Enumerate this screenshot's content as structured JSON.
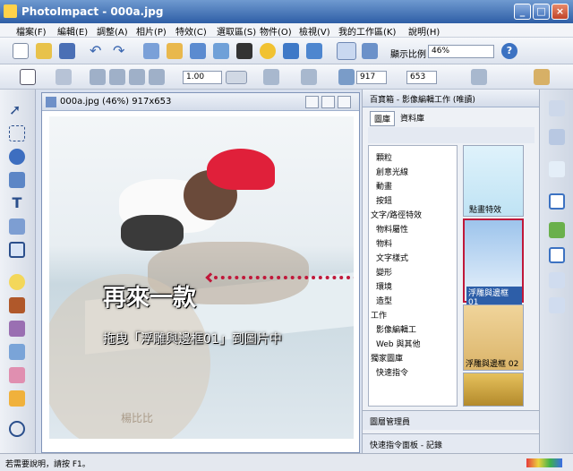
{
  "window": {
    "title": "PhotoImpact - 000a.jpg"
  },
  "menu": [
    "檔案(F)",
    "編輯(E)",
    "調整(A)",
    "相片(P)",
    "特效(C)",
    "選取區(S)",
    "物件(O)",
    "檢視(V)",
    "我的工作區(K)",
    "說明(H)"
  ],
  "toolbar": {
    "zoom_label": "顯示比例",
    "zoom_value": "46%"
  },
  "toolbar2": {
    "rotate_value": "1.00",
    "width_value": "917",
    "height_value": "653"
  },
  "document": {
    "title": "000a.jpg (46%) 917x653"
  },
  "canvas": {
    "heading": "再來一款",
    "instruction": "拖曳「浮雕與邊框01」到圖片中",
    "watermark": "楊比比"
  },
  "panel": {
    "title": "百寶箱 - 影像編輯工作 (唯讀)",
    "tabs": [
      "圖庫",
      "資料庫"
    ],
    "tree": [
      "顆粒",
      "創意光線",
      "動畫",
      "按鈕",
      "文字/路徑特效",
      "物料屬性",
      "物料",
      "文字樣式",
      "變形",
      "環境",
      "造型",
      "工作",
      "影像編輯工",
      "Web 與其他",
      "獨家圖庫",
      "快速指令"
    ],
    "thumbs": [
      "點畫特效",
      "浮雕與邊框 01",
      "浮雕與邊框 02"
    ],
    "layer_manager": "圖層管理員",
    "quick_panel": "快速指令面板 - 記錄"
  },
  "status": {
    "text": "若需要說明，請按 F1。"
  },
  "colors": {
    "accent": "#cc1e2e",
    "select": "#c0183a"
  }
}
